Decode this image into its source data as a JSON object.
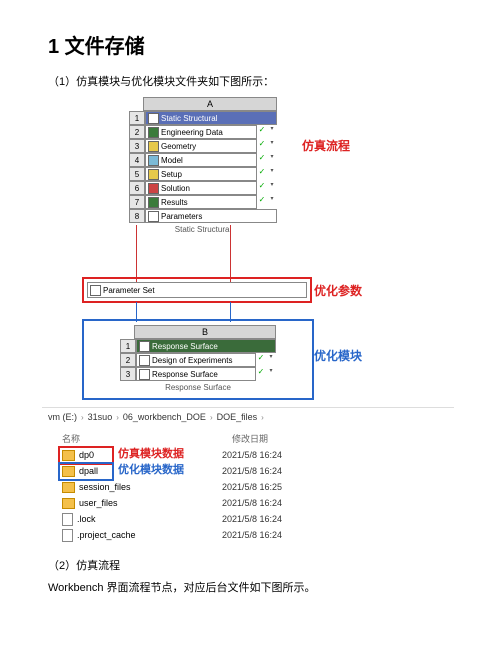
{
  "doc": {
    "heading": "1 文件存储",
    "para1": "（1）仿真模块与优化模块文件夹如下图所示：",
    "para2": "（2）仿真流程",
    "para3": "Workbench 界面流程节点，对应后台文件如下图所示。"
  },
  "wb": {
    "colA": "A",
    "colB": "B",
    "sysA_name": "Static Structural",
    "rowsA": [
      {
        "n": "1",
        "label": "Static Structural",
        "title": true,
        "tick": ""
      },
      {
        "n": "2",
        "label": "Engineering Data",
        "tick": "✓"
      },
      {
        "n": "3",
        "label": "Geometry",
        "tick": "✓"
      },
      {
        "n": "4",
        "label": "Model",
        "tick": "✓"
      },
      {
        "n": "5",
        "label": "Setup",
        "tick": "✓"
      },
      {
        "n": "6",
        "label": "Solution",
        "tick": "✓"
      },
      {
        "n": "7",
        "label": "Results",
        "tick": "✓"
      },
      {
        "n": "8",
        "label": "Parameters",
        "tick": ""
      }
    ],
    "paramSet": "Parameter Set",
    "rowsB": [
      {
        "n": "1",
        "label": "Response Surface",
        "title": true,
        "tick": ""
      },
      {
        "n": "2",
        "label": "Design of Experiments",
        "tick": "✓"
      },
      {
        "n": "3",
        "label": "Response Surface",
        "tick": "✓"
      }
    ],
    "sysB_name": "Response Surface"
  },
  "annot": {
    "simFlow": "仿真流程",
    "optParams": "优化参数",
    "optModule": "优化模块",
    "simData": "仿真模块数据",
    "optData": "优化模块数据"
  },
  "fs": {
    "bc": [
      "vm (E:)",
      "31suo",
      "06_workbench_DOE",
      "DOE_files"
    ],
    "head_name": "名称",
    "head_date": "修改日期",
    "rows": [
      {
        "name": "dp0",
        "date": "2021/5/8 16:24",
        "kind": "folder"
      },
      {
        "name": "dpall",
        "date": "2021/5/8 16:24",
        "kind": "folder"
      },
      {
        "name": "session_files",
        "date": "2021/5/8 16:25",
        "kind": "folder"
      },
      {
        "name": "user_files",
        "date": "2021/5/8 16:24",
        "kind": "folder"
      },
      {
        "name": ".lock",
        "date": "2021/5/8 16:24",
        "kind": "file"
      },
      {
        "name": ".project_cache",
        "date": "2021/5/8 16:24",
        "kind": "file"
      }
    ]
  }
}
